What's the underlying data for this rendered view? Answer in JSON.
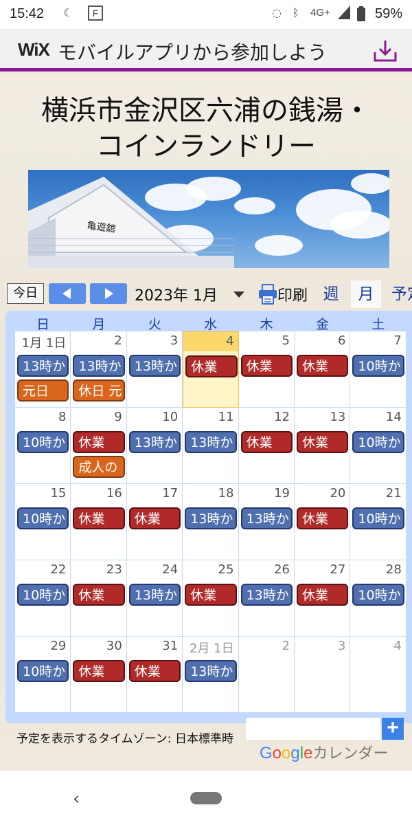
{
  "status_bar": {
    "time": "15:42",
    "network": "4G+",
    "battery": "59%"
  },
  "wix_banner": {
    "logo": "WiX",
    "text": "モバイルアプリから参加しよう",
    "accent_color": "#8a1a92"
  },
  "site": {
    "title_line1": "横浜市金沢区六浦の銭湯・",
    "title_line2": "コインランドリー",
    "hero_sign": "亀遊舘"
  },
  "toolbar": {
    "today": "今日",
    "month": "2023年 1月",
    "print": "印刷",
    "views": [
      "週",
      "月",
      "予定"
    ]
  },
  "weekdays": [
    "日",
    "月",
    "火",
    "水",
    "木",
    "金",
    "土"
  ],
  "weeks": [
    [
      {
        "day": "1月 1日",
        "events": [
          {
            "t": "13時か",
            "c": "blue"
          },
          {
            "t": "元日",
            "c": "orange"
          }
        ]
      },
      {
        "day": "2",
        "events": [
          {
            "t": "13時か",
            "c": "blue"
          },
          {
            "t": "休日 元",
            "c": "orange"
          }
        ]
      },
      {
        "day": "3",
        "events": [
          {
            "t": "13時か",
            "c": "blue"
          }
        ]
      },
      {
        "day": "4",
        "today": true,
        "events": [
          {
            "t": "休業",
            "c": "red"
          }
        ]
      },
      {
        "day": "5",
        "events": [
          {
            "t": "休業",
            "c": "red"
          }
        ]
      },
      {
        "day": "6",
        "events": [
          {
            "t": "休業",
            "c": "red"
          }
        ]
      },
      {
        "day": "7",
        "events": [
          {
            "t": "10時か",
            "c": "blue"
          }
        ]
      }
    ],
    [
      {
        "day": "8",
        "events": [
          {
            "t": "10時か",
            "c": "blue"
          }
        ]
      },
      {
        "day": "9",
        "events": [
          {
            "t": "休業",
            "c": "red"
          },
          {
            "t": "成人の",
            "c": "orange"
          }
        ]
      },
      {
        "day": "10",
        "events": [
          {
            "t": "13時か",
            "c": "blue"
          }
        ]
      },
      {
        "day": "11",
        "events": [
          {
            "t": "13時か",
            "c": "blue"
          }
        ]
      },
      {
        "day": "12",
        "events": [
          {
            "t": "休業",
            "c": "red"
          }
        ]
      },
      {
        "day": "13",
        "events": [
          {
            "t": "休業",
            "c": "red"
          }
        ]
      },
      {
        "day": "14",
        "events": [
          {
            "t": "10時か",
            "c": "blue"
          }
        ]
      }
    ],
    [
      {
        "day": "15",
        "events": [
          {
            "t": "10時か",
            "c": "blue"
          }
        ]
      },
      {
        "day": "16",
        "events": [
          {
            "t": "休業",
            "c": "red"
          }
        ]
      },
      {
        "day": "17",
        "events": [
          {
            "t": "休業",
            "c": "red"
          }
        ]
      },
      {
        "day": "18",
        "events": [
          {
            "t": "13時か",
            "c": "blue"
          }
        ]
      },
      {
        "day": "19",
        "events": [
          {
            "t": "13時か",
            "c": "blue"
          }
        ]
      },
      {
        "day": "20",
        "events": [
          {
            "t": "休業",
            "c": "red"
          }
        ]
      },
      {
        "day": "21",
        "events": [
          {
            "t": "10時か",
            "c": "blue"
          }
        ]
      }
    ],
    [
      {
        "day": "22",
        "events": [
          {
            "t": "10時か",
            "c": "blue"
          }
        ]
      },
      {
        "day": "23",
        "events": [
          {
            "t": "休業",
            "c": "red"
          }
        ]
      },
      {
        "day": "24",
        "events": [
          {
            "t": "13時か",
            "c": "blue"
          }
        ]
      },
      {
        "day": "25",
        "events": [
          {
            "t": "休業",
            "c": "red"
          }
        ]
      },
      {
        "day": "26",
        "events": [
          {
            "t": "13時か",
            "c": "blue"
          }
        ]
      },
      {
        "day": "27",
        "events": [
          {
            "t": "休業",
            "c": "red"
          }
        ]
      },
      {
        "day": "28",
        "events": [
          {
            "t": "10時か",
            "c": "blue"
          }
        ]
      }
    ],
    [
      {
        "day": "29",
        "events": [
          {
            "t": "10時か",
            "c": "blue"
          }
        ]
      },
      {
        "day": "30",
        "events": [
          {
            "t": "休業",
            "c": "red"
          }
        ]
      },
      {
        "day": "31",
        "events": [
          {
            "t": "休業",
            "c": "red"
          }
        ]
      },
      {
        "day": "2月 1日",
        "other": true,
        "events": [
          {
            "t": "13時か",
            "c": "blue"
          }
        ]
      },
      {
        "day": "2",
        "other": true,
        "events": []
      },
      {
        "day": "3",
        "other": true,
        "events": []
      },
      {
        "day": "4",
        "other": true,
        "events": []
      }
    ]
  ],
  "footer": {
    "timezone": "予定を表示するタイムゾーン: 日本標準時",
    "google_letters": [
      "G",
      "o",
      "o",
      "g",
      "l",
      "e"
    ],
    "calendar_label": "カレンダー",
    "add_symbol": "+"
  }
}
